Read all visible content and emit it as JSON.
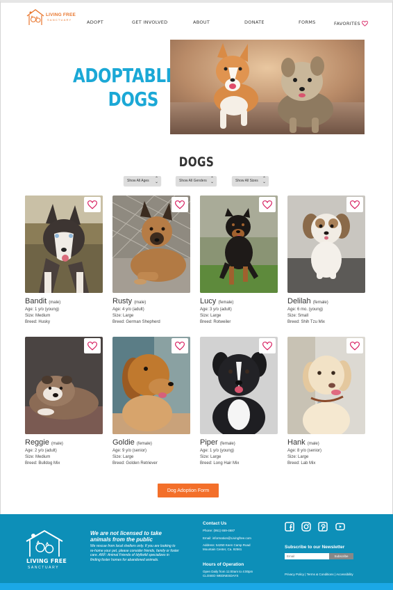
{
  "brand": {
    "name": "LIVING FREE",
    "sub": "SANCTUARY"
  },
  "nav": {
    "adopt": "ADOPT",
    "involved": "GET INVOLVED",
    "about": "ABOUT",
    "donate": "DONATE",
    "forms": "FORMS",
    "favorites": "FAVORITES"
  },
  "hero": {
    "line1": "ADOPTABLE",
    "line2": "DOGS"
  },
  "section_title": "DOGS",
  "filters": {
    "ages": "Show All Ages",
    "genders": "Show All Genders",
    "sizes": "Show All Sizes"
  },
  "dogs": [
    {
      "name": "Bandit",
      "sex": "(male)",
      "age": "Age: 1 y/o (young)",
      "size": "Size: Medium",
      "breed": "Breed: Husky"
    },
    {
      "name": "Rusty",
      "sex": "(male)",
      "age": "Age: 4 y/o (adult)",
      "size": "Size: Large",
      "breed": "Breed: German Shepherd"
    },
    {
      "name": "Lucy",
      "sex": "(female)",
      "age": "Age: 3 y/o (adult)",
      "size": "Size: Large",
      "breed": "Breed: Rotweiler"
    },
    {
      "name": "Delilah",
      "sex": "(female)",
      "age": "Age: 6 mo. (young)",
      "size": "Size: Small",
      "breed": "Breed: Shih Tzu Mix"
    },
    {
      "name": "Reggie",
      "sex": "(male)",
      "age": "Age: 2 y/o (adult)",
      "size": "Size: Medium",
      "breed": "Breed: Bulldog Mix"
    },
    {
      "name": "Goldie",
      "sex": "(female)",
      "age": "Age: 9 y/o (senior)",
      "size": "Size: Large",
      "breed": "Breed: Golden Retriever"
    },
    {
      "name": "Piper",
      "sex": "(female)",
      "age": "Age: 1 y/o (young)",
      "size": "Size: Large",
      "breed": "Breed: Long Hair Mix"
    },
    {
      "name": "Hank",
      "sex": "(male)",
      "age": "Age: 8 y/o (senior)",
      "size": "Size: Large",
      "breed": "Breed: Lab Mix"
    }
  ],
  "adopt_form_button": "Dog Adoption Form",
  "footer": {
    "logo_name": "LIVING FREE",
    "logo_sub": "SANCTUARY",
    "note": "We are not licensed to take animals from the public",
    "para": "We rescue from local shelters only. If you are looking to re-home your pet, please consider friends, family or foster care. ARF: Animal Friends of Idyllwild specializes in finding foster homes for abandoned animals.",
    "contact_title": "Contact Us",
    "phone": "Phone: (951) 659-4687",
    "email": "Email: information@Livingfree.com",
    "address1": "Address: 54250 Keen Camp Road",
    "address2": "Mountain Center, Ca. 92561",
    "hours_title": "Hours of Operation",
    "hours1": "Open Daily from 11:00am to 4:00pm",
    "hours2": "CLOSED WEDNESDAYS",
    "newsletter_title": "Subscribe to our Newsletter",
    "email_placeholder": "Email",
    "subscribe": "Subscribe",
    "privacy": "Privacy Policy",
    "terms": "Terms & Conditions",
    "accessibility": "Accessibility",
    "sep": "|"
  },
  "colors": {
    "accent": "#1ba8d6",
    "orange": "#f36f2a",
    "heart": "#d6185b",
    "footer": "#0d8fb8"
  },
  "icons": [
    "heart-icon",
    "facebook-icon",
    "instagram-icon",
    "pinterest-icon",
    "youtube-icon",
    "chevron-updown-icon"
  ]
}
